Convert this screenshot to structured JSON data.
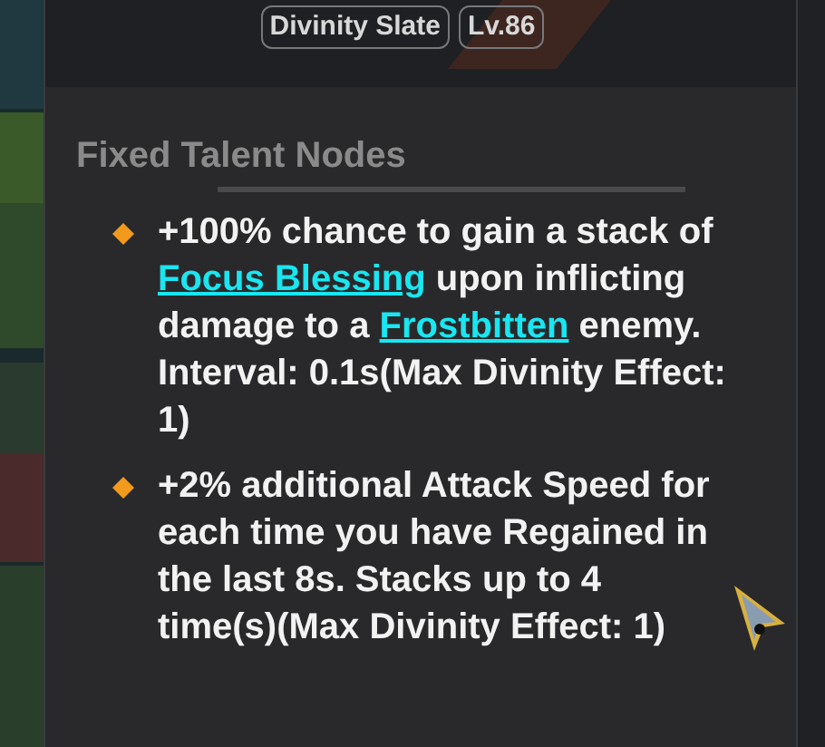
{
  "header": {
    "tags": [
      "Divinity Slate",
      "Lv.86"
    ]
  },
  "section": {
    "title": "Fixed Talent Nodes",
    "nodes": [
      {
        "segments": [
          {
            "kind": "plain",
            "text": "+100% chance to gain a stack of "
          },
          {
            "kind": "link",
            "text": "Focus Blessing"
          },
          {
            "kind": "plain",
            "text": " upon inflicting damage to a "
          },
          {
            "kind": "link",
            "text": "Frostbitten"
          },
          {
            "kind": "plain",
            "text": " enemy. Interval: 0.1s(Max Divinity Effect: 1)"
          }
        ]
      },
      {
        "segments": [
          {
            "kind": "plain",
            "text": "+2% additional Attack Speed for each time you have Regained in the last 8s. Stacks up to 4 time(s)(Max Divinity Effect: 1)"
          }
        ]
      }
    ]
  }
}
